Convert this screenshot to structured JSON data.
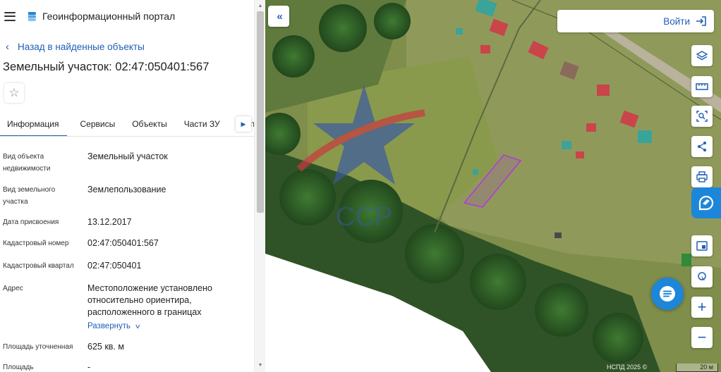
{
  "header": {
    "portal_title": "Геоинформационный портал"
  },
  "nav": {
    "back_label": "Назад в найденные объекты"
  },
  "object": {
    "title": "Земельный участок: 02:47:050401:567"
  },
  "tabs": [
    {
      "label": "Информация",
      "active": true
    },
    {
      "label": "Сервисы"
    },
    {
      "label": "Объекты"
    },
    {
      "label": "Части ЗУ"
    },
    {
      "label": "Состав"
    }
  ],
  "properties": [
    {
      "key": "Вид объекта недвижимости",
      "value": "Земельный участок"
    },
    {
      "key": "Вид земельного участка",
      "value": "Землепользование"
    },
    {
      "key": "Дата присвоения",
      "value": "13.12.2017"
    },
    {
      "key": "Кадастровый номер",
      "value": "02:47:050401:567"
    },
    {
      "key": "Кадастровый квартал",
      "value": "02:47:050401"
    },
    {
      "key": "Адрес",
      "value": "Местоположение установлено относительно ориентира, расположенного в границах"
    },
    {
      "key": "Площадь уточненная",
      "value": "625 кв. м"
    },
    {
      "key": "Площадь",
      "value": "-"
    }
  ],
  "address_expand_label": "Развернуть",
  "map": {
    "login_label": "Войти",
    "copyright": "НСПД 2025 ©",
    "scale_label": "20 м",
    "accent_color": "#1f5fb4",
    "parcel_outline_color": "#b33ad8",
    "tools": [
      "layers-icon",
      "ruler-icon",
      "select-area-icon",
      "share-icon",
      "print-icon",
      "basemap-icon",
      "geolocate-icon",
      "zoom-in",
      "zoom-out"
    ]
  }
}
